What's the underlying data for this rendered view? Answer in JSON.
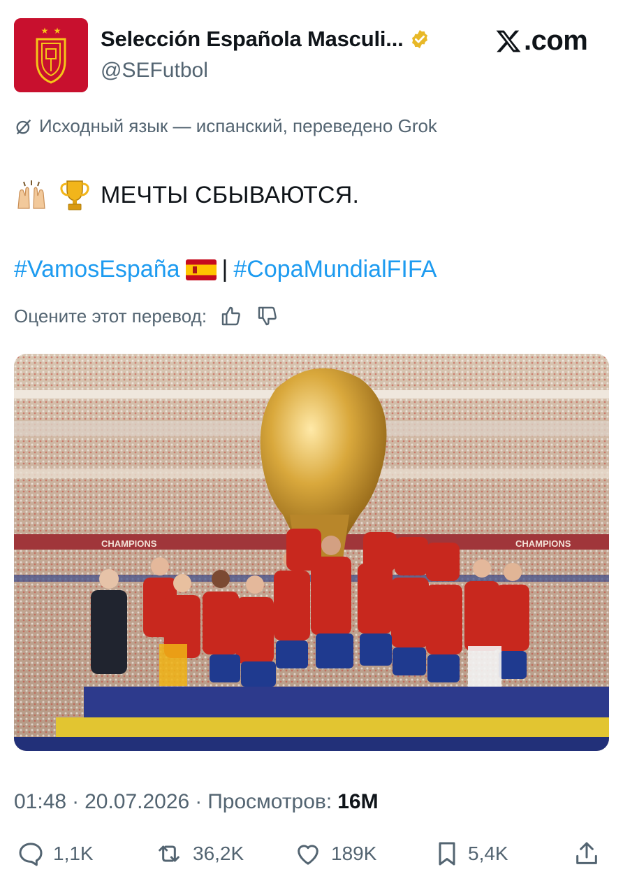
{
  "header": {
    "account_name": "Selección Española Masculi...",
    "handle": "@SEFutbol",
    "verified_icon": "verified-badge-gold",
    "platform_label": ".com"
  },
  "translation": {
    "note": "Исходный язык — испанский, переведено Grok",
    "rate_label": "Оцените этот перевод:"
  },
  "tweet": {
    "emojis": [
      "raised-hands",
      "trophy"
    ],
    "text": "МЕЧТЫ СБЫВАЮТСЯ.",
    "hashtag1": "#VamosEspaña",
    "separator": "|",
    "hashtag2": "#CopaMundialFIFA"
  },
  "photo": {
    "banner_left": "CHAMPIONS",
    "banner_right": "CHAMPIONS"
  },
  "meta": {
    "time": "01:48",
    "date": "20.07.2026",
    "views_label": "Просмотров:",
    "views_value": "16M"
  },
  "actions": {
    "replies": "1,1K",
    "reposts": "36,2K",
    "likes": "189K",
    "bookmarks": "5,4K"
  },
  "colors": {
    "link": "#1d9bf0",
    "secondary_text": "#536471",
    "brand_red": "#c8102e",
    "verified_gold": "#e8b827"
  }
}
